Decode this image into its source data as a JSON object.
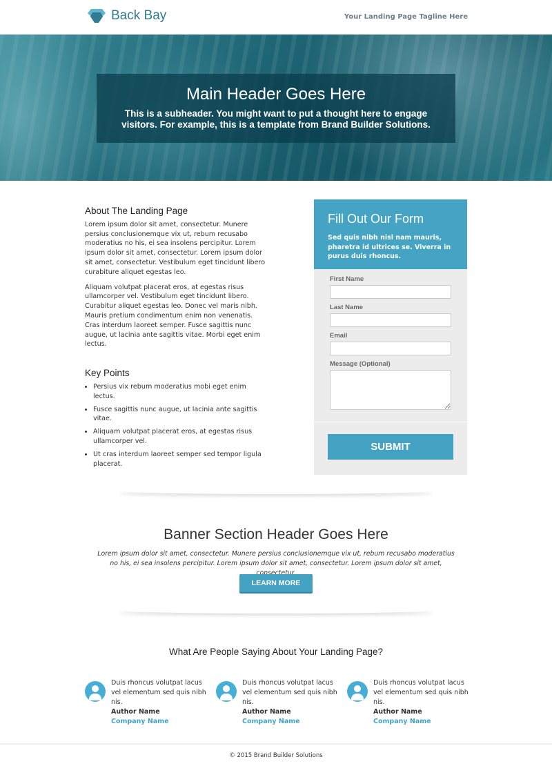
{
  "header": {
    "logo_text": "Back Bay",
    "tagline": "Your Landing Page Tagline Here"
  },
  "hero": {
    "title": "Main Header Goes Here",
    "subtitle": "This is a subheader. You might want to put a thought here to engage visitors. For example, this is a template from Brand Builder Solutions."
  },
  "about": {
    "title": "About The Landing Page",
    "paragraphs": [
      "Lorem ipsum dolor sit amet, consectetur. Munere persius conclusionemque vix ut, rebum recusabo moderatius no his, ei sea insolens percipitur. Lorem ipsum dolor sit amet, consectetur. Lorem ipsum dolor sit amet, consectetur. Vestibulum eget tincidunt libero curabiture aliquet egestas leo.",
      "Aliquam volutpat placerat eros, at egestas risus ullamcorper vel. Vestibulum eget tincidunt libero. Curabitur aliquet egestas leo. Donec vel maris nibh. Mauris pretium condimentum enim non venenatis. Cras interdum laoreet semper. Fusce sagittis nunc augue, ut lacinia ante sagittis vitae. Morbi eget enim lectus."
    ]
  },
  "key_points": {
    "title": "Key Points",
    "items": [
      "Persius vix rebum moderatius mobi eget enim lectus.",
      "Fusce sagittis nunc augue, ut lacinia ante sagittis vitae.",
      "Aliquam volutpat placerat eros, at egestas risus ullamcorper vel.",
      "Ut cras interdum laoreet semper sed tempor ligula placerat."
    ]
  },
  "form": {
    "title": "Fill Out Our Form",
    "description": "Sed quis nibh nisl nam mauris, pharetra id ultrices se. Viverra in purus duis rhoncus.",
    "fields": [
      {
        "label": "First Name",
        "value": ""
      },
      {
        "label": "Last Name",
        "value": ""
      },
      {
        "label": "Email",
        "value": ""
      },
      {
        "label": "Message (Optional)",
        "value": ""
      }
    ],
    "submit_label": "SUBMIT"
  },
  "banner": {
    "title": "Banner Section Header Goes Here",
    "text": "Lorem ipsum dolor sit amet, consectetur. Munere persius conclusionemque vix ut, rebum recusabo moderatius no his, ei sea insolens percipitur. Lorem ipsum dolor sit amet, consectetur. Lorem ipsum dolor sit amet, consectetur.",
    "button_label": "LEARN MORE"
  },
  "testimonials": {
    "title": "What Are People Saying About Your Landing Page?",
    "items": [
      {
        "quote": "Duis rhoncus volutpat lacus vel elementum sed quis nibh nis.",
        "author": "Author Name",
        "company": "Company Name"
      },
      {
        "quote": "Duis rhoncus volutpat lacus vel elementum sed quis nibh nis.",
        "author": "Author Name",
        "company": "Company Name"
      },
      {
        "quote": "Duis rhoncus volutpat lacus vel elementum sed quis nibh nis.",
        "author": "Author Name",
        "company": "Company Name"
      }
    ]
  },
  "footer": {
    "text": "© 2015 Brand Builder Solutions"
  },
  "colors": {
    "accent": "#45a3c3",
    "brand": "#2f7d93",
    "form_bg": "#ececec"
  }
}
